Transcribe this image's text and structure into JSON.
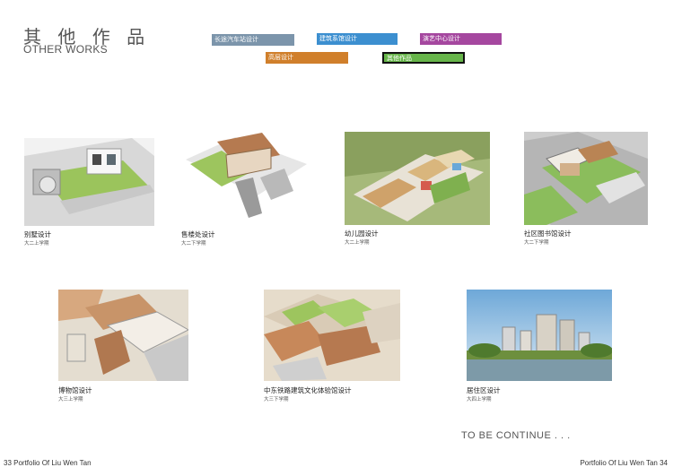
{
  "header": {
    "title_cn": "其 他 作 品",
    "title_en": "OTHER WORKS"
  },
  "tabs": [
    {
      "label": "长途汽车站设计",
      "color": "#7c95ab"
    },
    {
      "label": "建筑系馆设计",
      "color": "#3c8fd0"
    },
    {
      "label": "演艺中心设计",
      "color": "#a5479f"
    },
    {
      "label": "高层设计",
      "color": "#d07f2b"
    },
    {
      "label": "其他作品",
      "color": "#67b54a"
    }
  ],
  "works": [
    {
      "name": "别墅设计",
      "term": "大二上学期"
    },
    {
      "name": "售楼处设计",
      "term": "大二下学期"
    },
    {
      "name": "幼儿园设计",
      "term": "大二上学期"
    },
    {
      "name": "社区图书馆设计",
      "term": "大二下学期"
    },
    {
      "name": "博物馆设计",
      "term": "大三上学期"
    },
    {
      "name": "中东铁路建筑文化体验馆设计",
      "term": "大三下学期"
    },
    {
      "name": "居住区设计",
      "term": "大四上学期"
    }
  ],
  "continue_text": "TO BE CONTINUE . . .",
  "footer": {
    "left": "33 Portfolio Of Liu Wen Tan",
    "right": "Portfolio Of Liu Wen Tan 34"
  }
}
